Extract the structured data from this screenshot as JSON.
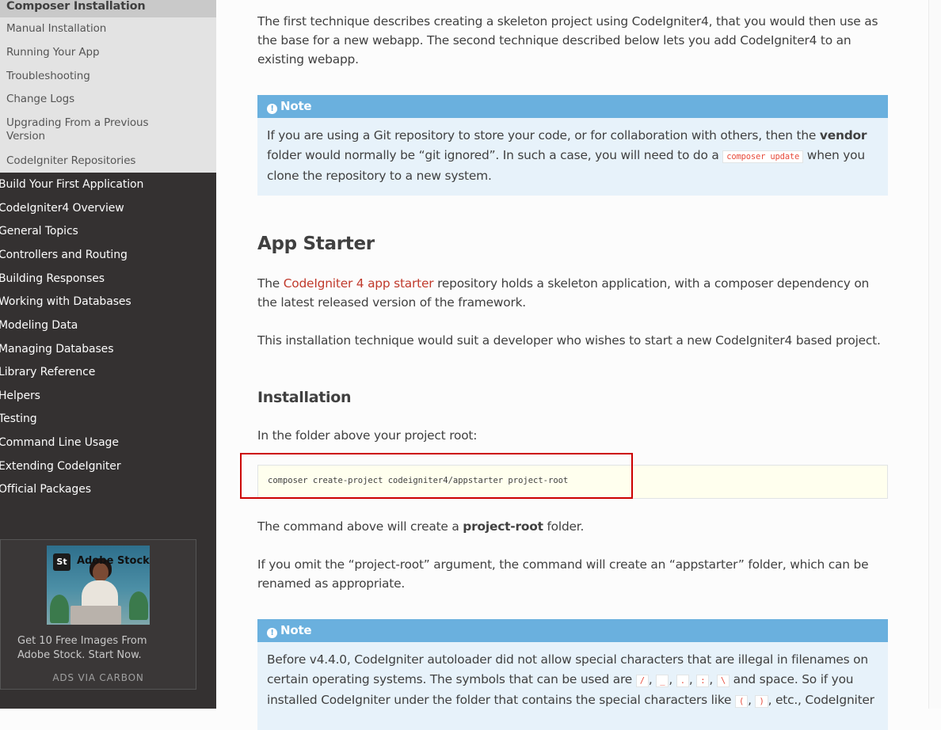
{
  "sidebar": {
    "current_section": "Composer Installation",
    "sub_items": [
      {
        "label": "Manual Installation"
      },
      {
        "label": "Running Your App"
      },
      {
        "label": "Troubleshooting"
      },
      {
        "label": "Change Logs"
      },
      {
        "label": "Upgrading From a Previous Version"
      },
      {
        "label": "CodeIgniter Repositories"
      }
    ],
    "nav_items": [
      {
        "label": "Build Your First Application"
      },
      {
        "label": "CodeIgniter4 Overview"
      },
      {
        "label": "General Topics"
      },
      {
        "label": "Controllers and Routing"
      },
      {
        "label": "Building Responses"
      },
      {
        "label": "Working with Databases"
      },
      {
        "label": "Modeling Data"
      },
      {
        "label": "Managing Databases"
      },
      {
        "label": "Library Reference"
      },
      {
        "label": "Helpers"
      },
      {
        "label": "Testing"
      },
      {
        "label": "Command Line Usage"
      },
      {
        "label": "Extending CodeIgniter"
      },
      {
        "label": "Official Packages"
      }
    ],
    "ad": {
      "logo": "St",
      "brand": "Adobe Stock",
      "text": "Get 10 Free Images From Adobe Stock. Start Now.",
      "via": "ADS VIA CARBON"
    }
  },
  "content": {
    "intro": "The first technique describes creating a skeleton project using CodeIgniter4, that you would then use as the base for a new webapp. The second technique described below lets you add CodeIgniter4 to an existing webapp.",
    "note1": {
      "title": "Note",
      "before_bold": "If you are using a Git repository to store your code, or for collaboration with others, then the ",
      "bold": "vendor",
      "after_bold": " folder would normally be “git ignored”. In such a case, you will need to do a ",
      "code": "composer update",
      "end": " when you clone the repository to a new system."
    },
    "app_starter_heading": "App Starter",
    "app_starter_pre": "The ",
    "app_starter_link": "CodeIgniter 4 app starter",
    "app_starter_post": " repository holds a skeleton application, with a composer dependency on the latest released version of the framework.",
    "technique_para": "This installation technique would suit a developer who wishes to start a new CodeIgniter4 based project.",
    "installation_heading": "Installation",
    "folder_para": "In the folder above your project root:",
    "command": "composer create-project codeigniter4/appstarter project-root",
    "cmd_pre": "The command above will create a ",
    "cmd_bold": "project-root",
    "cmd_post": " folder.",
    "omit_para": "If you omit the “project-root” argument, the command will create an “appstarter” folder, which can be renamed as appropriate.",
    "note2": {
      "title": "Note",
      "line1": "Before v4.4.0, CodeIgniter autoloader did not allow special characters that are illegal in filenames on certain operating systems. The symbols that can be used are ",
      "sym1": "/",
      "sym2": "_",
      "sym3": ".",
      "sym4": ":",
      "sym5": "\\",
      "mid": " and space. So if you installed CodeIgniter under the folder that contains the special characters like ",
      "sym6": "(",
      "sym7": ")",
      "end": ", etc., CodeIgniter"
    }
  },
  "colors": {
    "sidebar_bg": "#343131",
    "note_header": "#6ab0de",
    "note_bg": "#e7f2fa",
    "link": "#c0392b",
    "highlight": "#cc0000"
  }
}
